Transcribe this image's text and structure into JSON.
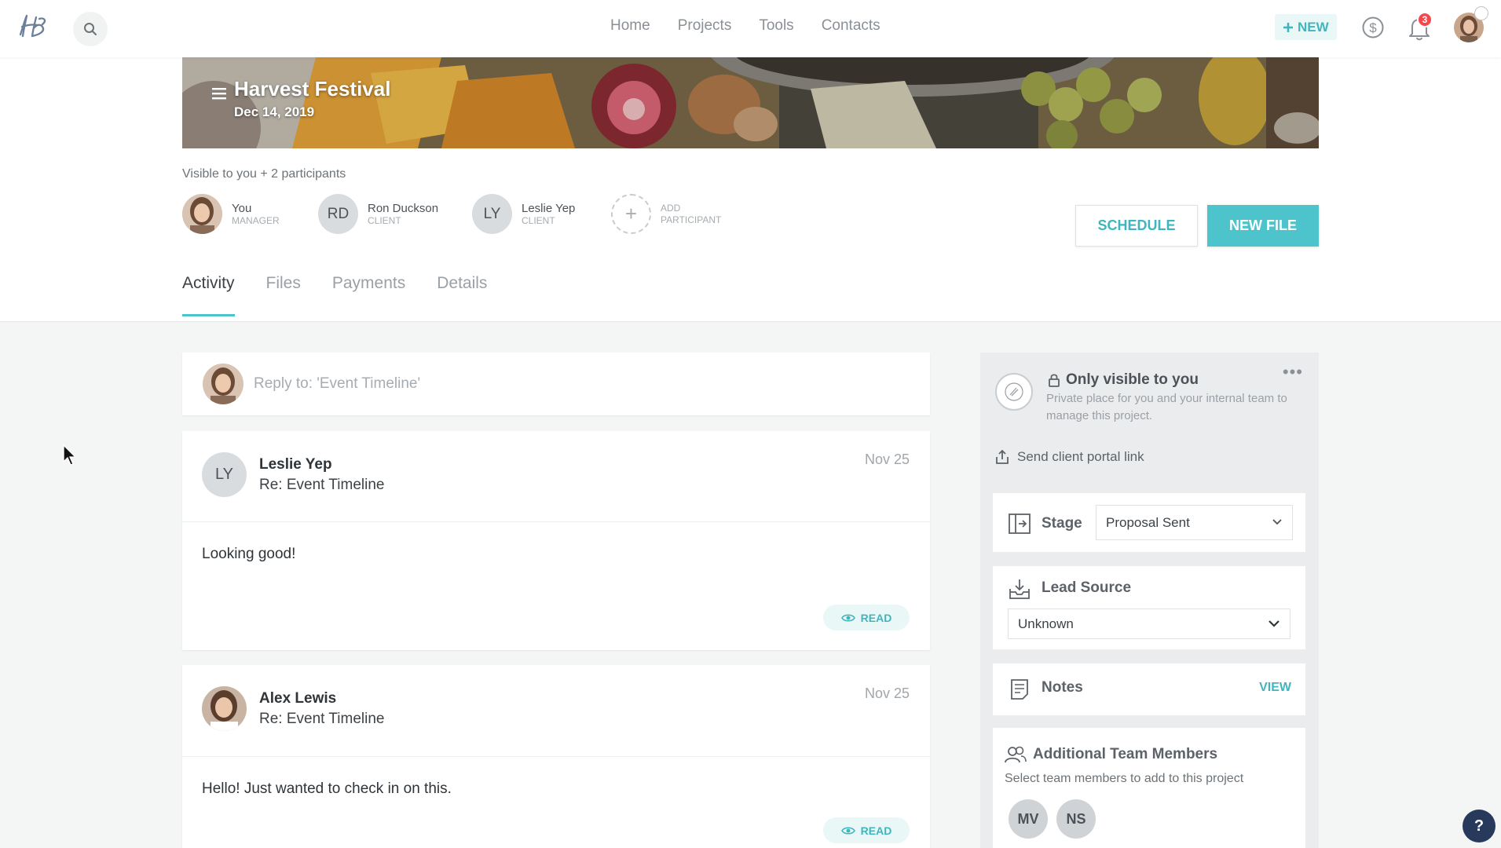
{
  "nav": {
    "links": [
      "Home",
      "Projects",
      "Tools",
      "Contacts"
    ],
    "new_label": "NEW",
    "notification_count": "3",
    "icons": [
      "search-icon",
      "dollar-icon",
      "bell-icon"
    ]
  },
  "project": {
    "title": "Harvest Festival",
    "date": "Dec 14, 2019"
  },
  "participants": {
    "visibility": "Visible to you + 2 participants",
    "list": [
      {
        "initials": "",
        "name": "You",
        "role": "MANAGER"
      },
      {
        "initials": "RD",
        "name": "Ron Duckson",
        "role": "CLIENT"
      },
      {
        "initials": "LY",
        "name": "Leslie Yep",
        "role": "CLIENT"
      },
      {
        "initials": "+",
        "name": "ADD",
        "role": "PARTICIPANT"
      }
    ]
  },
  "actions": {
    "schedule": "SCHEDULE",
    "new_file": "NEW FILE"
  },
  "tabs": [
    "Activity",
    "Files",
    "Payments",
    "Details"
  ],
  "reply": {
    "placeholder": "Reply to: 'Event Timeline'"
  },
  "messages": [
    {
      "initials": "LY",
      "name": "Leslie Yep",
      "subject": "Re: Event Timeline",
      "date": "Nov 25",
      "body": "Looking good!",
      "status": "READ"
    },
    {
      "initials": "",
      "name": "Alex Lewis",
      "subject": "Re: Event Timeline",
      "date": "Nov 25",
      "body": "Hello! Just wanted to check in on this.",
      "status": "READ"
    }
  ],
  "sidebar": {
    "private_title": "Only visible to you",
    "private_desc": "Private place for you and your internal team to manage this project.",
    "send_link": "Send client portal link",
    "stage_label": "Stage",
    "stage_value": "Proposal Sent",
    "lead_label": "Lead Source",
    "lead_value": "Unknown",
    "notes_label": "Notes",
    "notes_action": "VIEW",
    "team_title": "Additional Team Members",
    "team_sub": "Select team members to add to this project",
    "team_members": [
      "MV",
      "NS"
    ]
  },
  "help_label": "?",
  "colors": {
    "accent": "#4dc3cb",
    "badge": "#f5474c",
    "help": "#283a5c"
  }
}
